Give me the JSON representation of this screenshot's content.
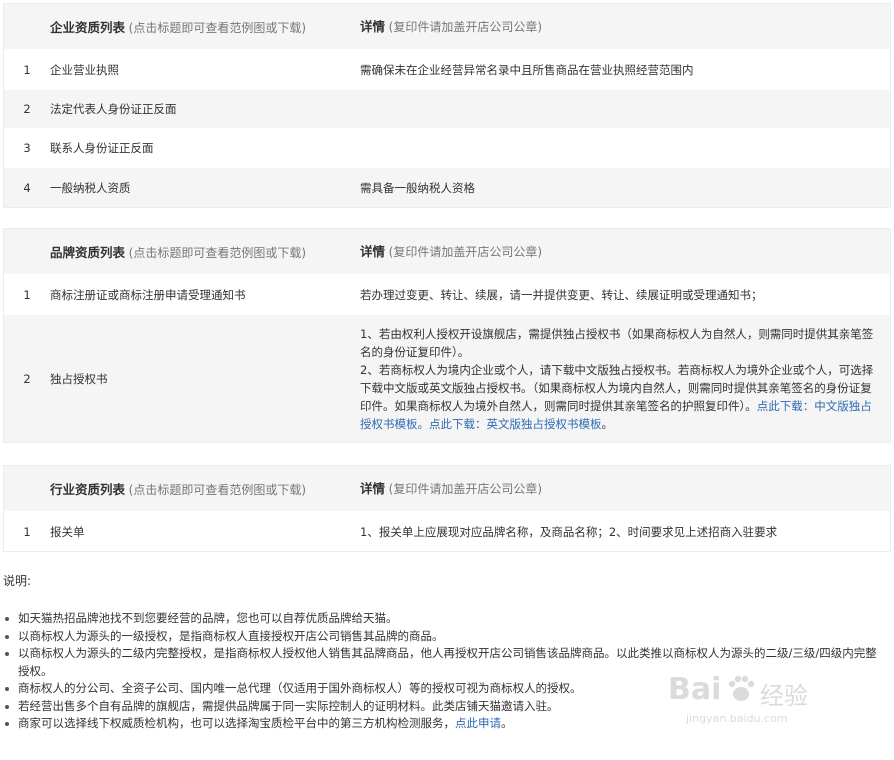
{
  "enterprise_table": {
    "title": "企业资质列表",
    "title_hint": "(点击标题即可查看范例图或下载)",
    "detail_title": "详情",
    "detail_hint": "(复印件请加盖开店公司公章)",
    "rows": [
      {
        "idx": "1",
        "name": "企业营业执照",
        "detail": "需确保未在企业经营异常名录中且所售商品在营业执照经营范围内"
      },
      {
        "idx": "2",
        "name": "法定代表人身份证正反面",
        "detail": ""
      },
      {
        "idx": "3",
        "name": "联系人身份证正反面",
        "detail": ""
      },
      {
        "idx": "4",
        "name": "一般纳税人资质",
        "detail": "需具备一般纳税人资格"
      }
    ]
  },
  "brand_table": {
    "title": "品牌资质列表",
    "title_hint": "(点击标题即可查看范例图或下载)",
    "detail_title": "详情",
    "detail_hint": "(复印件请加盖开店公司公章)",
    "rows": [
      {
        "idx": "1",
        "name": "商标注册证或商标注册申请受理通知书",
        "detail": "若办理过变更、转让、续展，请一并提供变更、转让、续展证明或受理通知书；"
      },
      {
        "idx": "2",
        "name": "独占授权书",
        "detail_p1": "1、若由权利人授权开设旗舰店，需提供独占授权书（如果商标权人为自然人，则需同时提供其亲笔签名的身份证复印件）。",
        "detail_p2": "2、若商标权人为境内企业或个人，请下载中文版独占授权书。若商标权人为境外企业或个人，可选择下载中文版或英文版独占授权书。（如果商标权人为境内自然人，则需同时提供其亲笔签名的身份证复印件。如果商标权人为境外自然人，则需同时提供其亲笔签名的护照复印件）。",
        "link1": "点此下载：中文版独占授权书模板。",
        "link2": "点此下载：英文版独占授权书模板",
        "tail": "。"
      }
    ]
  },
  "industry_table": {
    "title": "行业资质列表",
    "title_hint": "(点击标题即可查看范例图或下载)",
    "detail_title": "详情",
    "detail_hint": "(复印件请加盖开店公司公章)",
    "rows": [
      {
        "idx": "1",
        "name": "报关单",
        "detail": "1、报关单上应展现对应品牌名称，及商品名称；2、时间要求见上述招商入驻要求"
      }
    ]
  },
  "notes": {
    "title": "说明:",
    "items": [
      "如天猫热招品牌池找不到您要经营的品牌，您也可以自荐优质品牌给天猫。",
      "以商标权人为源头的一级授权，是指商标权人直接授权开店公司销售其品牌的商品。",
      "以商标权人为源头的二级内完整授权，是指商标权人授权他人销售其品牌商品，他人再授权开店公司销售该品牌商品。以此类推以商标权人为源头的二级/三级/四级内完整授权。",
      "商标权人的分公司、全资子公司、国内唯一总代理（仅适用于国外商标权人）等的授权可视为商标权人的授权。",
      "若经营出售多个自有品牌的旗舰店，需提供品牌属于同一实际控制人的证明材料。此类店铺天猫邀请入驻。"
    ],
    "last_item_text": "商家可以选择线下权威质检机构，也可以选择淘宝质检平台中的第三方机构检测服务，",
    "last_item_link": "点此申请",
    "last_item_tail": "。"
  },
  "watermark": {
    "brand": "Bai",
    "brand2": "经验",
    "url": "jingyan.baidu.com"
  }
}
